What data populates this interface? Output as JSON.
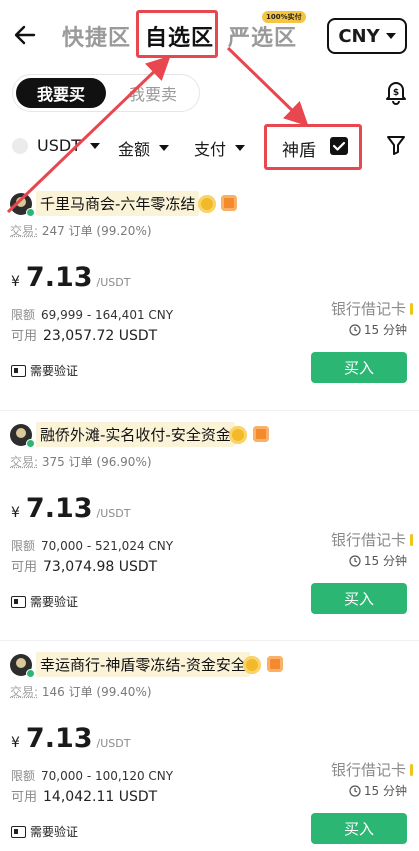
{
  "header": {
    "tabs": [
      {
        "label": "快捷区"
      },
      {
        "label": "自选区"
      },
      {
        "label": "严选区"
      }
    ],
    "tab_badge": "100%实付",
    "currency": "CNY"
  },
  "trade_toggle": {
    "buy": "我要买",
    "sell": "我要卖"
  },
  "filters": {
    "coin": "USDT",
    "amount": "金额",
    "payment": "支付",
    "shield": "神盾"
  },
  "merchants": [
    {
      "name": "千里马商会-六年零冻结",
      "trades_label": "交易:",
      "trades": "247 订单 (99.20%)",
      "currency_symbol": "¥",
      "price": "7.13",
      "price_unit": "/USDT",
      "limit_label": "限额",
      "limit": "69,999 - 164,401 CNY",
      "available_label": "可用",
      "available": "23,057.72 USDT",
      "payment_method": "银行借记卡",
      "time_limit": "15 分钟",
      "verify": "需要验证",
      "buy_label": "买入"
    },
    {
      "name": "融侨外滩-实名收付-安全资金",
      "trades_label": "交易:",
      "trades": "375 订单 (96.90%)",
      "currency_symbol": "¥",
      "price": "7.13",
      "price_unit": "/USDT",
      "limit_label": "限额",
      "limit": "70,000 - 521,024 CNY",
      "available_label": "可用",
      "available": "73,074.98 USDT",
      "payment_method": "银行借记卡",
      "time_limit": "15 分钟",
      "verify": "需要验证",
      "buy_label": "买入"
    },
    {
      "name": "幸运商行-神盾零冻结-资金安全",
      "trades_label": "交易:",
      "trades": "146 订单 (99.40%)",
      "currency_symbol": "¥",
      "price": "7.13",
      "price_unit": "/USDT",
      "limit_label": "限额",
      "limit": "70,000 - 100,120 CNY",
      "available_label": "可用",
      "available": "14,042.11 USDT",
      "payment_method": "银行借记卡",
      "time_limit": "15 分钟",
      "verify": "需要验证",
      "buy_label": "买入"
    }
  ],
  "colors": {
    "accent_green": "#2bb673",
    "annotation_red": "#e8474f"
  },
  "icons": [
    "back-arrow-icon",
    "chevron-down-icon",
    "bell-dollar-icon",
    "filter-icon",
    "checkbox-checked-icon",
    "clock-icon",
    "id-card-icon",
    "verified-gold-icon",
    "merchant-orange-icon"
  ]
}
